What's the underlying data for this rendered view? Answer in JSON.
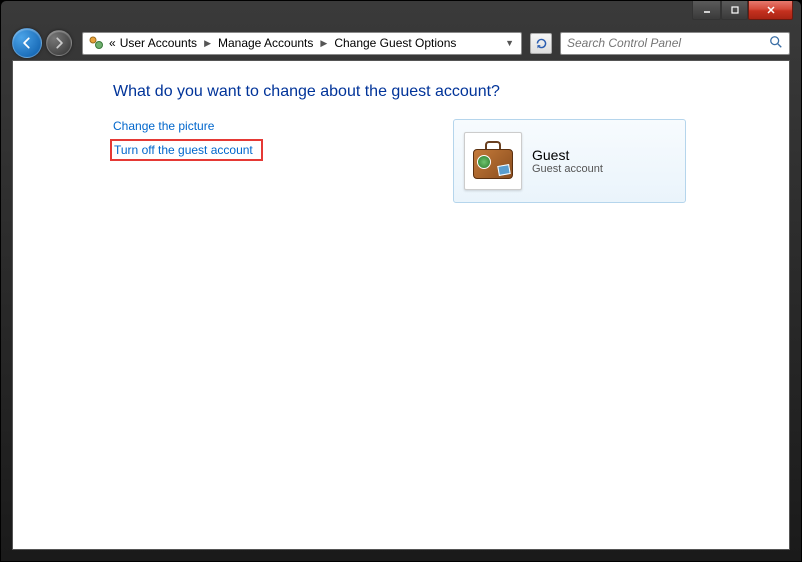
{
  "breadcrumb": {
    "prefix": "«",
    "items": [
      "User Accounts",
      "Manage Accounts",
      "Change Guest Options"
    ]
  },
  "search": {
    "placeholder": "Search Control Panel"
  },
  "page": {
    "title": "What do you want to change about the guest account?"
  },
  "links": {
    "change_picture": "Change the picture",
    "turn_off": "Turn off the guest account"
  },
  "account": {
    "name": "Guest",
    "type": "Guest account"
  }
}
